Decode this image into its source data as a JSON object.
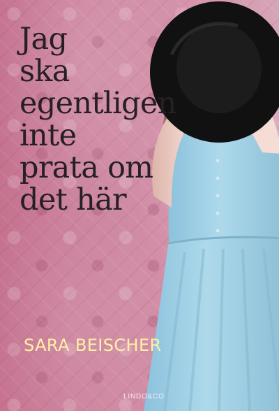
{
  "book": {
    "title_lines": [
      "Jag",
      "ska",
      "egentligen",
      "inte",
      "prata om",
      "det här"
    ],
    "author": "SARA BEISCHER",
    "publisher": "LINDO&CO"
  },
  "colors": {
    "background": "#cf8aa3",
    "title": "#262025",
    "author": "#fff1a8",
    "dress": "#a9d4e8",
    "hat": "#111111",
    "skin": "#f1d3cb",
    "nails": "#c3203a"
  }
}
